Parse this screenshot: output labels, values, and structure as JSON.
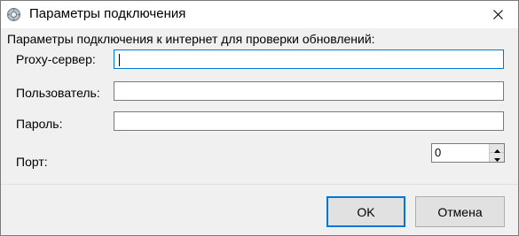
{
  "window": {
    "title": "Параметры подключения",
    "icon": "gear-globe-icon",
    "close_icon": "close-icon"
  },
  "group": {
    "caption": "Параметры подключения к интернет для проверки обновлений:"
  },
  "fields": {
    "proxy": {
      "label": "Proxy-сервер:",
      "value": ""
    },
    "user": {
      "label": "Пользователь:",
      "value": ""
    },
    "password": {
      "label": "Пароль:",
      "value": ""
    },
    "port": {
      "label": "Порт:",
      "value": "0"
    }
  },
  "buttons": {
    "ok": "OK",
    "cancel": "Отмена"
  },
  "colors": {
    "accent": "#0078d7",
    "background": "#f0f0f0",
    "button": "#e1e1e1"
  }
}
